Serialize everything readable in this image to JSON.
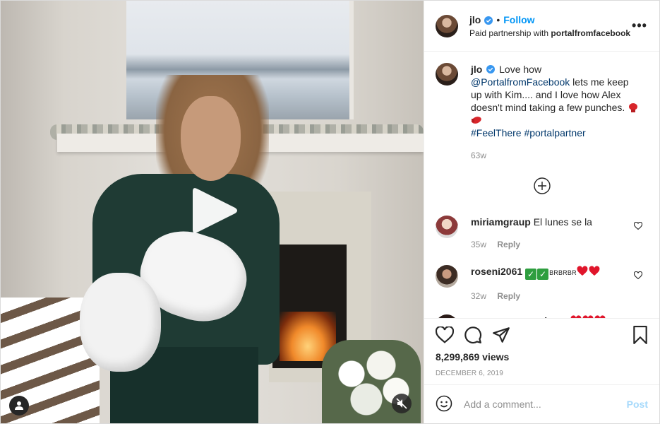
{
  "post": {
    "author": "jlo",
    "follow_label": "Follow",
    "dot": "•",
    "partnership_prefix": "Paid partnership with",
    "partner": "portalfromfacebook",
    "more_label": "•••"
  },
  "caption": {
    "username": "jlo",
    "text_1": "Love how",
    "mention": "@PortalfromFacebook",
    "text_2": "lets me keep up with Kim.... and I love how Alex doesn't mind taking a few punches.",
    "hashtag_1": "#FeelThere",
    "hashtag_2": "#portalpartner",
    "time": "63w"
  },
  "comments": [
    {
      "username": "miriamgraup",
      "text": "El lunes se la",
      "time": "35w",
      "reply": "Reply"
    },
    {
      "username": "roseni2061",
      "text": "BRBRBR",
      "time": "32w",
      "reply": "Reply"
    },
    {
      "username": "georgerusevmakeup",
      "text": "",
      "time": "",
      "reply": ""
    }
  ],
  "stats": {
    "views": "8,299,869 views",
    "date": "DECEMBER 6, 2019"
  },
  "composer": {
    "placeholder": "Add a comment...",
    "post_label": "Post"
  },
  "icons": {
    "verified": "verified-badge-icon",
    "play": "play-icon",
    "user_tag": "user-tag-icon",
    "mute": "muted-speaker-icon",
    "load_more": "plus-circle-icon",
    "like": "heart-icon",
    "comment": "comment-bubble-icon",
    "share": "paper-plane-icon",
    "save": "bookmark-icon",
    "emoji": "smiley-icon"
  },
  "colors": {
    "accent": "#0095f6",
    "link": "#00376b",
    "muted": "#8e8e8e",
    "text": "#262626"
  }
}
